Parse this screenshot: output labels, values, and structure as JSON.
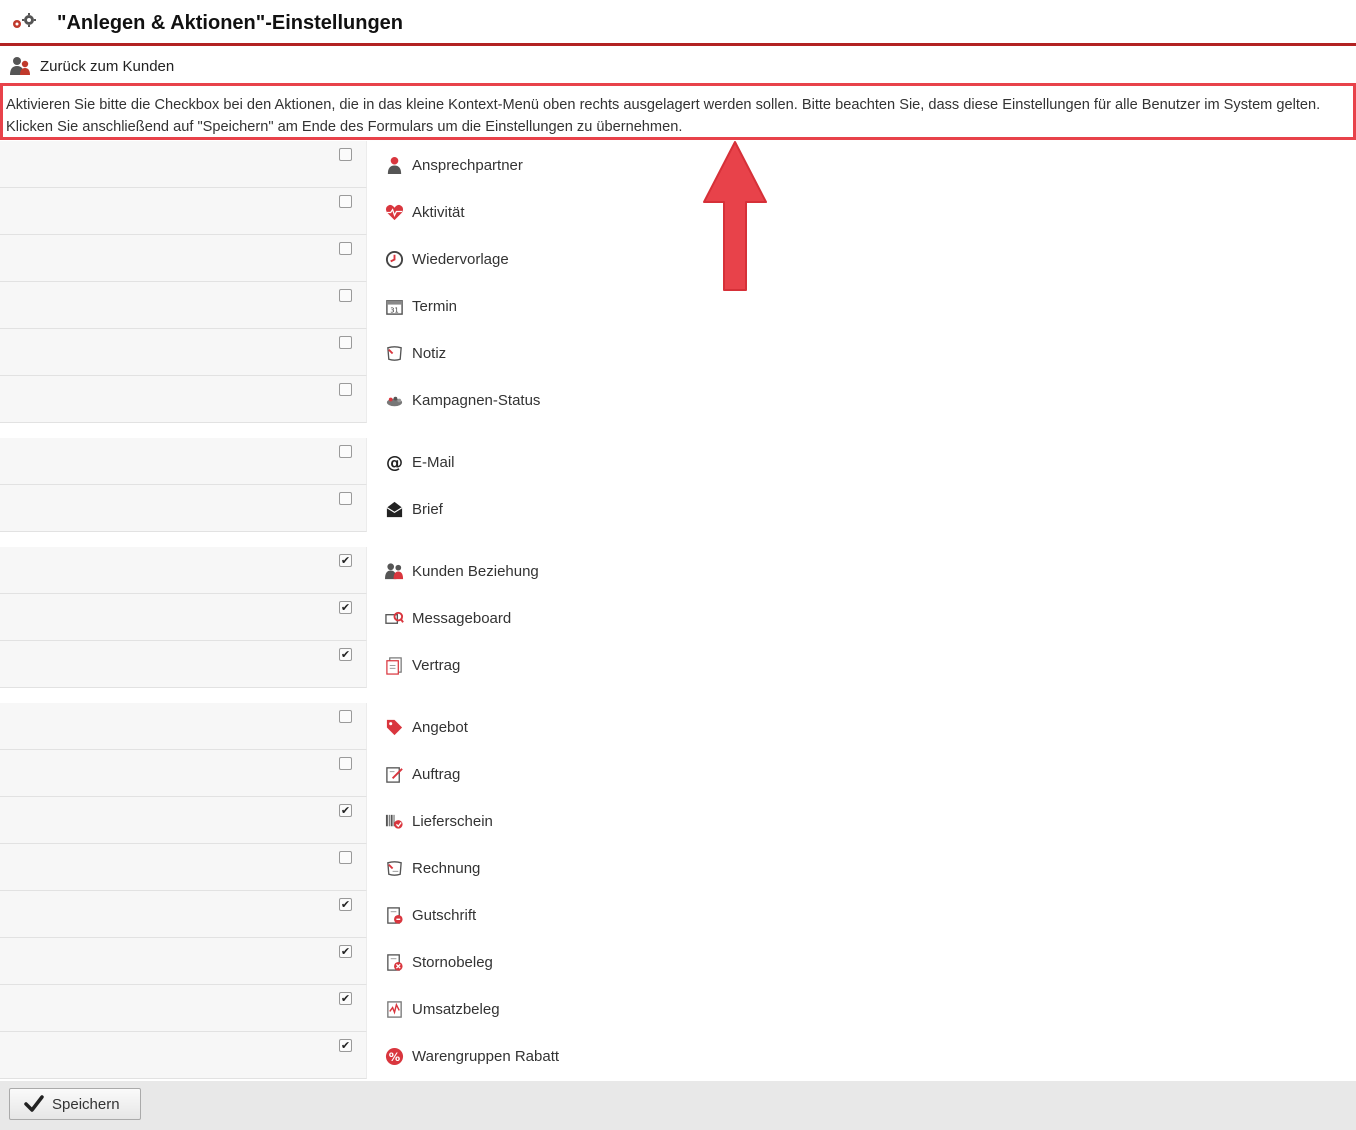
{
  "header": {
    "title": "\"Anlegen & Aktionen\"-Einstellungen",
    "icon": "gears-icon"
  },
  "back_link": {
    "label": "Zurück zum Kunden",
    "icon": "users-icon"
  },
  "info_text": {
    "line1": "Aktivieren Sie bitte die Checkbox bei den Aktionen, die in das kleine Kontext-Menü oben rechts ausgelagert werden sollen. Bitte beachten Sie, dass diese Einstellungen für alle Benutzer im System gelten.",
    "line2": "Klicken Sie anschließend auf \"Speichern\" am Ende des Formulars um die Einstellungen zu übernehmen."
  },
  "groups": [
    {
      "items": [
        {
          "label": "Ansprechpartner",
          "icon": "person-icon",
          "checked": false
        },
        {
          "label": "Aktivität",
          "icon": "heartbeat-icon",
          "checked": false
        },
        {
          "label": "Wiedervorlage",
          "icon": "clock-icon",
          "checked": false
        },
        {
          "label": "Termin",
          "icon": "calendar-icon",
          "checked": false
        },
        {
          "label": "Notiz",
          "icon": "note-icon",
          "checked": false
        },
        {
          "label": "Kampagnen-Status",
          "icon": "campaign-icon",
          "checked": false
        }
      ]
    },
    {
      "items": [
        {
          "label": "E-Mail",
          "icon": "at-icon",
          "checked": false
        },
        {
          "label": "Brief",
          "icon": "envelope-icon",
          "checked": false
        }
      ]
    },
    {
      "items": [
        {
          "label": "Kunden Beziehung",
          "icon": "users-icon",
          "checked": true
        },
        {
          "label": "Messageboard",
          "icon": "messageboard-icon",
          "checked": true
        },
        {
          "label": "Vertrag",
          "icon": "contract-icon",
          "checked": true
        }
      ]
    },
    {
      "items": [
        {
          "label": "Angebot",
          "icon": "tag-icon",
          "checked": false
        },
        {
          "label": "Auftrag",
          "icon": "order-icon",
          "checked": false
        },
        {
          "label": "Lieferschein",
          "icon": "barcode-icon",
          "checked": true
        },
        {
          "label": "Rechnung",
          "icon": "invoice-icon",
          "checked": false
        },
        {
          "label": "Gutschrift",
          "icon": "credit-icon",
          "checked": true
        },
        {
          "label": "Stornobeleg",
          "icon": "cancel-doc-icon",
          "checked": true
        },
        {
          "label": "Umsatzbeleg",
          "icon": "revenue-doc-icon",
          "checked": true
        },
        {
          "label": "Warengruppen Rabatt",
          "icon": "percent-icon",
          "checked": true
        }
      ]
    }
  ],
  "save_button": {
    "label": "Speichern",
    "icon": "checkmark-icon"
  },
  "colors": {
    "accent": "#b22222",
    "highlight": "#e8424a",
    "icon_red": "#d9363e"
  }
}
